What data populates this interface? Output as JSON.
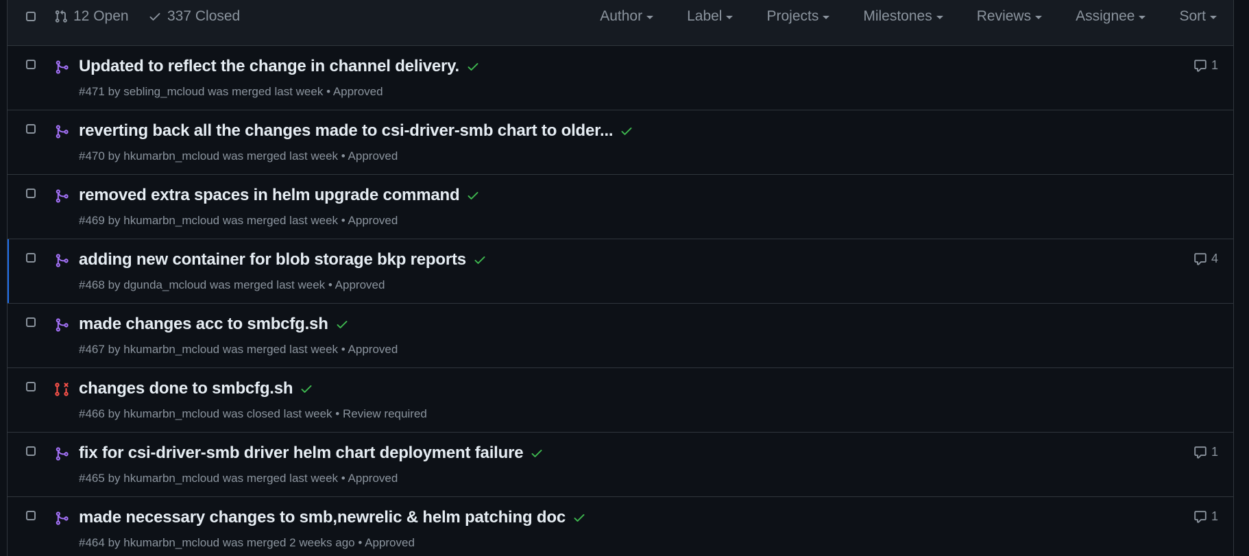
{
  "header": {
    "open_label": "12 Open",
    "closed_label": "337 Closed",
    "filters": [
      "Author",
      "Label",
      "Projects",
      "Milestones",
      "Reviews",
      "Assignee",
      "Sort"
    ]
  },
  "colors": {
    "merged": "#a371f7",
    "closed": "#f85149",
    "check": "#3fb950",
    "selected_bar": "#1f6feb"
  },
  "pull_requests": [
    {
      "title": "Updated to reflect the change in channel delivery.",
      "number": "#471",
      "by": "by",
      "author": "sebling_mcloud",
      "status_text": "was merged last week",
      "review": "Approved",
      "comments": "1",
      "state": "merged",
      "icon": "git-merge-icon"
    },
    {
      "title": "reverting back all the changes made to csi-driver-smb chart to older...",
      "number": "#470",
      "by": "by",
      "author": "hkumarbn_mcloud",
      "status_text": "was merged last week",
      "review": "Approved",
      "comments": "",
      "state": "merged",
      "icon": "git-merge-icon"
    },
    {
      "title": "removed extra spaces in helm upgrade command",
      "number": "#469",
      "by": "by",
      "author": "hkumarbn_mcloud",
      "status_text": "was merged last week",
      "review": "Approved",
      "comments": "",
      "state": "merged",
      "icon": "git-merge-icon"
    },
    {
      "title": "adding new container for blob storage bkp reports",
      "number": "#468",
      "by": "by",
      "author": "dgunda_mcloud",
      "status_text": "was merged last week",
      "review": "Approved",
      "comments": "4",
      "state": "merged",
      "icon": "git-merge-icon",
      "selected": true
    },
    {
      "title": "made changes acc to smbcfg.sh",
      "number": "#467",
      "by": "by",
      "author": "hkumarbn_mcloud",
      "status_text": "was merged last week",
      "review": "Approved",
      "comments": "",
      "state": "merged",
      "icon": "git-merge-icon"
    },
    {
      "title": "changes done to smbcfg.sh",
      "number": "#466",
      "by": "by",
      "author": "hkumarbn_mcloud",
      "status_text": "was closed last week",
      "review": "Review required",
      "comments": "",
      "state": "closed",
      "icon": "git-pull-request-closed-icon"
    },
    {
      "title": "fix for csi-driver-smb driver helm chart deployment failure",
      "number": "#465",
      "by": "by",
      "author": "hkumarbn_mcloud",
      "status_text": "was merged last week",
      "review": "Approved",
      "comments": "1",
      "state": "merged",
      "icon": "git-merge-icon"
    },
    {
      "title": "made necessary changes to smb,newrelic & helm patching doc",
      "number": "#464",
      "by": "by",
      "author": "hkumarbn_mcloud",
      "status_text": "was merged 2 weeks ago",
      "review": "Approved",
      "comments": "1",
      "state": "merged",
      "icon": "git-merge-icon"
    }
  ]
}
